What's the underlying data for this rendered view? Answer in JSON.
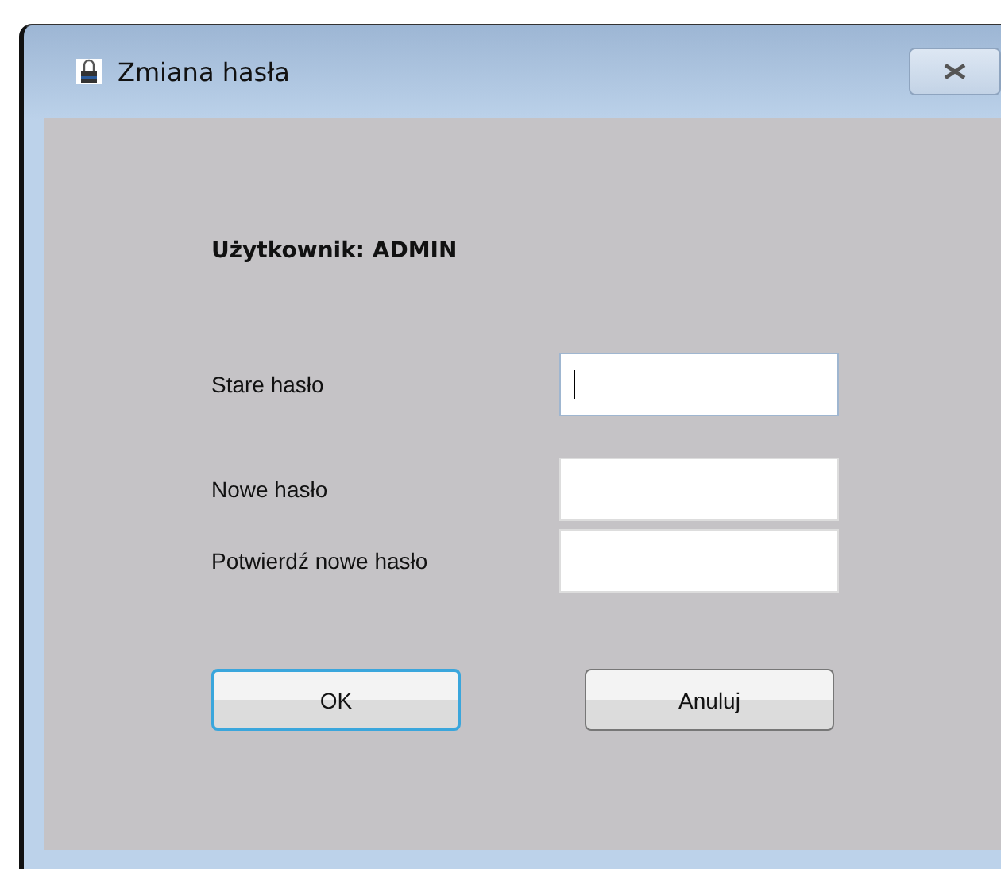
{
  "window": {
    "title": "Zmiana hasła"
  },
  "user_label": "Użytkownik: ADMIN",
  "fields": [
    {
      "label": "Stare hasło",
      "focused": true
    },
    {
      "label": "Nowe hasło",
      "focused": false
    },
    {
      "label": "Potwierdź nowe hasło",
      "focused": false
    }
  ],
  "buttons": [
    {
      "label": "OK",
      "default": true
    },
    {
      "label": "Anuluj",
      "default": false
    }
  ]
}
